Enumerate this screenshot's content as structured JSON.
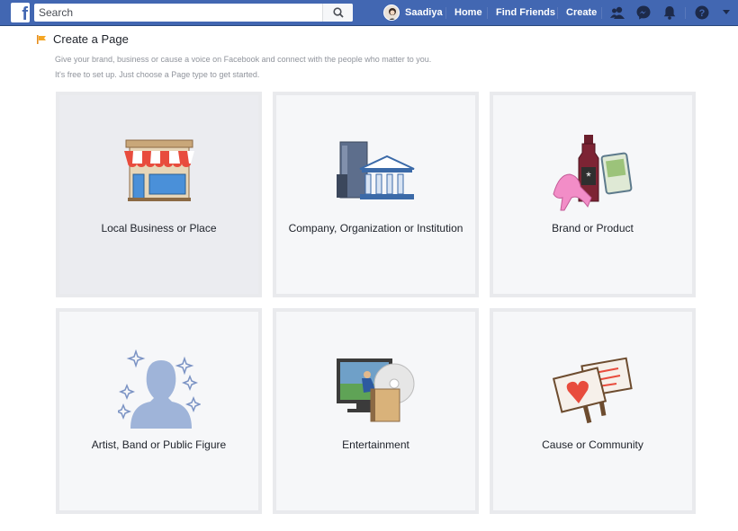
{
  "topbar": {
    "logo": "f",
    "search_placeholder": "Search",
    "user_name": "Saadiya",
    "nav": [
      "Home",
      "Find Friends",
      "Create"
    ],
    "icons": [
      "friend-requests-icon",
      "messenger-icon",
      "notifications-icon",
      "help-icon",
      "dropdown-arrow-icon"
    ]
  },
  "header": {
    "title": "Create a Page",
    "line1": "Give your brand, business or cause a voice on Facebook and connect with the people who matter to you.",
    "line2": "It's free to set up. Just choose a Page type to get started."
  },
  "cards": [
    {
      "label": "Local Business or Place",
      "icon": "storefront-icon"
    },
    {
      "label": "Company, Organization or Institution",
      "icon": "buildings-icon"
    },
    {
      "label": "Brand or Product",
      "icon": "products-icon"
    },
    {
      "label": "Artist, Band or Public Figure",
      "icon": "person-stars-icon"
    },
    {
      "label": "Entertainment",
      "icon": "media-icon"
    },
    {
      "label": "Cause or Community",
      "icon": "signs-icon"
    }
  ]
}
